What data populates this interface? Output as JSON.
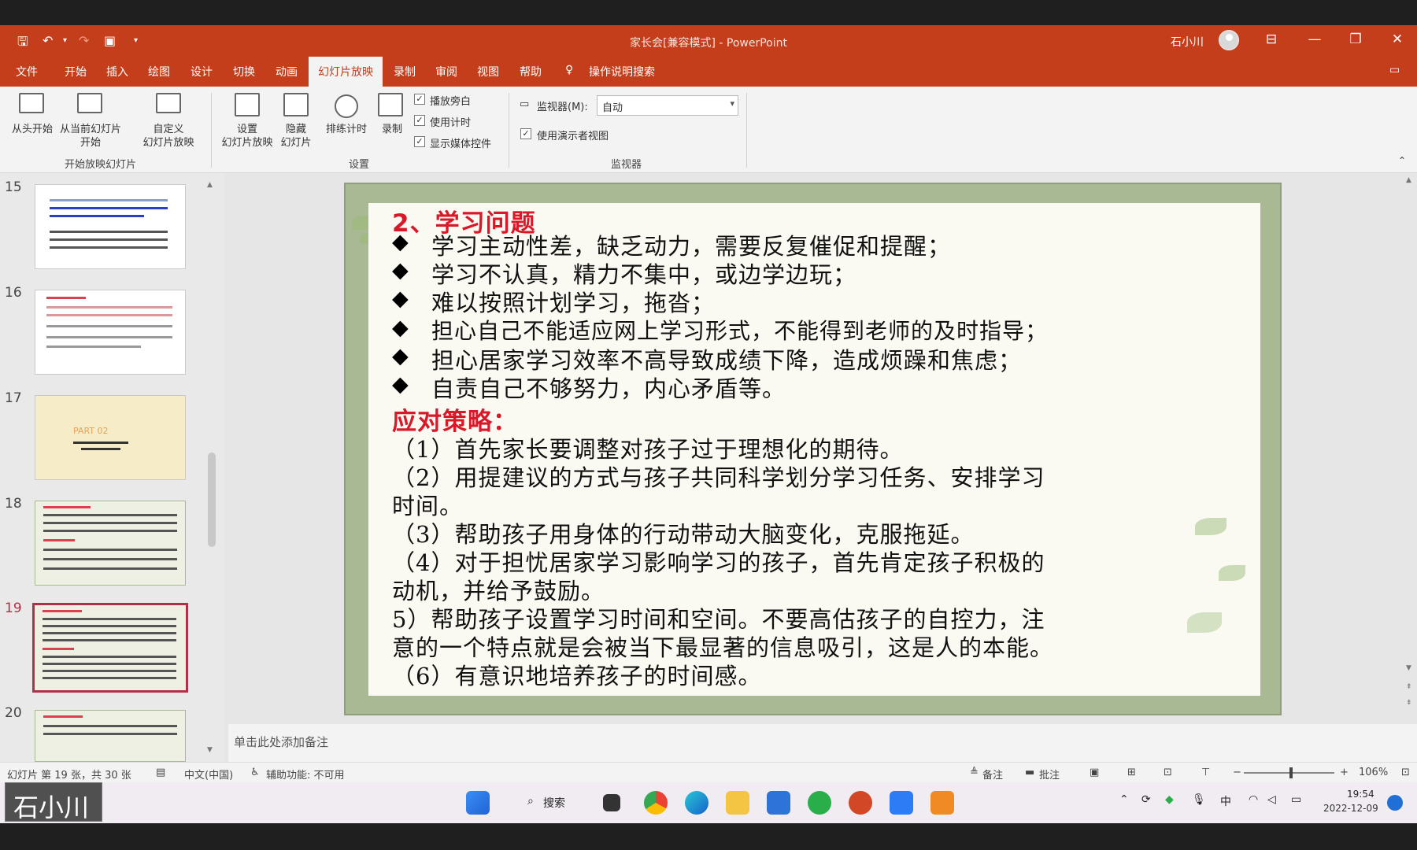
{
  "window": {
    "title": "家长会[兼容模式] - PowerPoint",
    "user_name": "石小川",
    "quick_access": [
      "save-icon",
      "undo-icon",
      "redo-icon",
      "present-icon"
    ],
    "controls": [
      "ribbon-display-icon",
      "minimize-icon",
      "restore-icon",
      "close-icon"
    ]
  },
  "menu": {
    "tabs": [
      "文件",
      "开始",
      "插入",
      "绘图",
      "设计",
      "切换",
      "动画",
      "幻灯片放映",
      "录制",
      "审阅",
      "视图",
      "帮助"
    ],
    "active_tab": "幻灯片放映",
    "tell_me": "操作说明搜索"
  },
  "ribbon": {
    "start_group": {
      "from_beginning": "从头开始",
      "from_current_l1": "从当前幻灯片",
      "from_current_l2": "开始",
      "custom_l1": "自定义",
      "custom_l2": "幻灯片放映",
      "group_label": "开始放映幻灯片"
    },
    "setup_group": {
      "setup_l1": "设置",
      "setup_l2": "幻灯片放映",
      "hide_l1": "隐藏",
      "hide_l2": "幻灯片",
      "rehearse": "排练计时",
      "record": "录制",
      "chk_narration": "播放旁白",
      "chk_timings": "使用计时",
      "chk_media": "显示媒体控件",
      "group_label": "设置"
    },
    "monitor_group": {
      "monitor_label": "监视器(M):",
      "monitor_value": "自动",
      "presenter_view": "使用演示者视图",
      "group_label": "监视器"
    }
  },
  "thumbnails": [
    {
      "num": "15"
    },
    {
      "num": "16"
    },
    {
      "num": "17",
      "text": "PART 02"
    },
    {
      "num": "18"
    },
    {
      "num": "19",
      "selected": true
    },
    {
      "num": "20"
    }
  ],
  "slide": {
    "heading": "2、学习问题",
    "bullets": [
      "学习主动性差，缺乏动力，需要反复催促和提醒；",
      "学习不认真，精力不集中，或边学边玩；",
      "难以按照计划学习，拖沓；",
      "担心自己不能适应网上学习形式，不能得到老师的及时指导；",
      "担心居家学习效率不高导致成绩下降，造成烦躁和焦虑；",
      "自责自己不够努力，内心矛盾等。"
    ],
    "strategy_heading": "应对策略：",
    "strategy_lines": [
      "（1）首先家长要调整对孩子过于理想化的期待。",
      "（2）用提建议的方式与孩子共同科学划分学习任务、安排学习",
      "时间。",
      "（3）帮助孩子用身体的行动带动大脑变化，克服拖延。",
      "（4）对于担忧居家学习影响学习的孩子，首先肯定孩子积极的",
      "动机，并给予鼓励。",
      "5）帮助孩子设置学习时间和空间。不要高估孩子的自控力，注",
      "意的一个特点就是会被当下最显著的信息吸引，这是人的本能。",
      "（6）有意识地培养孩子的时间感。"
    ]
  },
  "notes_placeholder": "单击此处添加备注",
  "status": {
    "slide_info": "幻灯片 第 19 张，共 30 张",
    "language": "中文(中国)",
    "accessibility": "辅助功能: 不可用",
    "notes_btn": "备注",
    "comments_btn": "批注",
    "zoom_percent": "106%",
    "zoom_level": 1.06
  },
  "taskbar": {
    "search_label": "搜索",
    "ime": "中",
    "time": "19:54",
    "date": "2022-12-09",
    "apps": [
      "start-icon",
      "search-icon",
      "taskview-icon",
      "chrome-icon",
      "edge-icon",
      "explorer-icon",
      "mail-icon",
      "wechat-icon",
      "powerpoint-icon",
      "feishu-icon",
      "app-icon"
    ]
  },
  "overlay_name": "石小川",
  "colors": {
    "accent": "#c43e1c",
    "slide_frame": "#a9b994",
    "heading_red": "#d9182a",
    "selected_thumb": "#b0304a"
  }
}
